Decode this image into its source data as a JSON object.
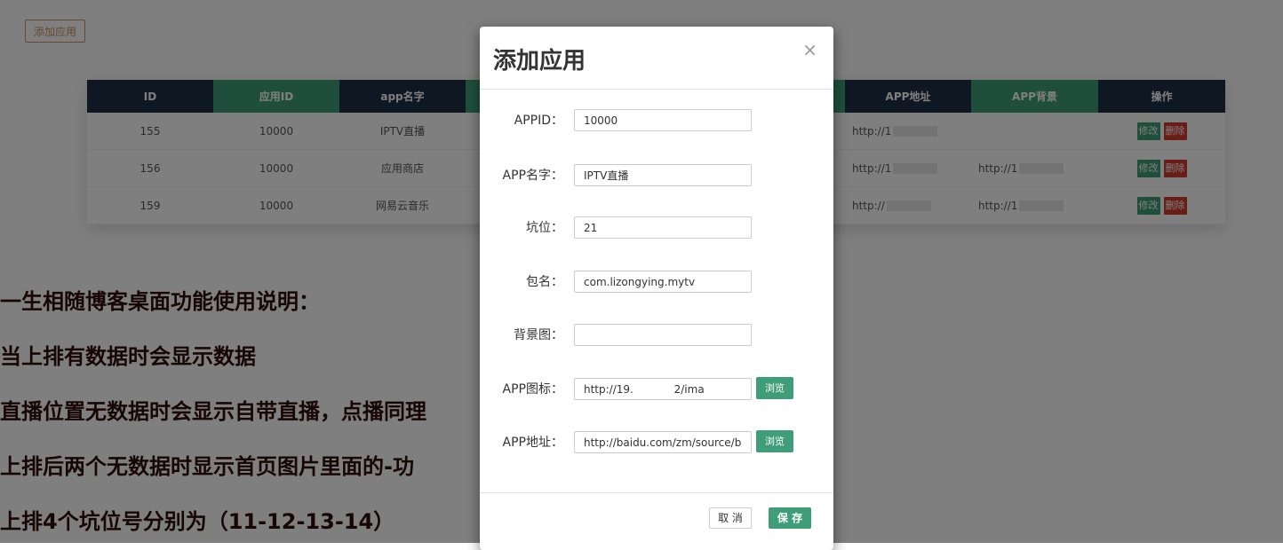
{
  "toolbar": {
    "add_app_label": "添加应用"
  },
  "table": {
    "headers": [
      "ID",
      "应用ID",
      "app名字",
      "",
      "",
      "",
      "APP地址",
      "APP背景",
      "操作"
    ],
    "rows": [
      {
        "id": "155",
        "app_id": "10000",
        "name": "IPTV直播",
        "url": "http://1",
        "bg": "",
        "edit": "修改",
        "del": "删除"
      },
      {
        "id": "156",
        "app_id": "10000",
        "name": "应用商店",
        "url": "http://1",
        "bg": "http://1",
        "edit": "修改",
        "del": "删除"
      },
      {
        "id": "159",
        "app_id": "10000",
        "name": "网易云音乐",
        "url": "http://",
        "bg": "http://1",
        "edit": "修改",
        "del": "删除"
      }
    ]
  },
  "notes": [
    "一生相随博客桌面功能使用说明：",
    "当上排有数据时会显示数据",
    "直播位置无数据时会显示自带直播，点播同理",
    "上排后两个无数据时显示首页图片里面的-功",
    "上排4个坑位号分别为（11-12-13-14）"
  ],
  "modal": {
    "title": "添加应用",
    "close": "×",
    "fields": [
      {
        "label": "APPID：",
        "value": "10000"
      },
      {
        "label": "APP名字：",
        "value": "IPTV直播"
      },
      {
        "label": "坑位：",
        "value": "21"
      },
      {
        "label": "包名：",
        "value": "com.lizongying.mytv"
      },
      {
        "label": "背景图：",
        "value": ""
      },
      {
        "label": "APP图标：",
        "value": "http://19.            2/ima"
      },
      {
        "label": "APP地址：",
        "value": "http://baidu.com/zm/source/bas"
      }
    ],
    "browse": "浏览",
    "cancel": "取 消",
    "save": "保 存"
  },
  "colors": {
    "header_dark": "#1f2e45",
    "header_green": "#3f9e79",
    "accent": "#3f9e79",
    "danger": "#d03b2f"
  }
}
